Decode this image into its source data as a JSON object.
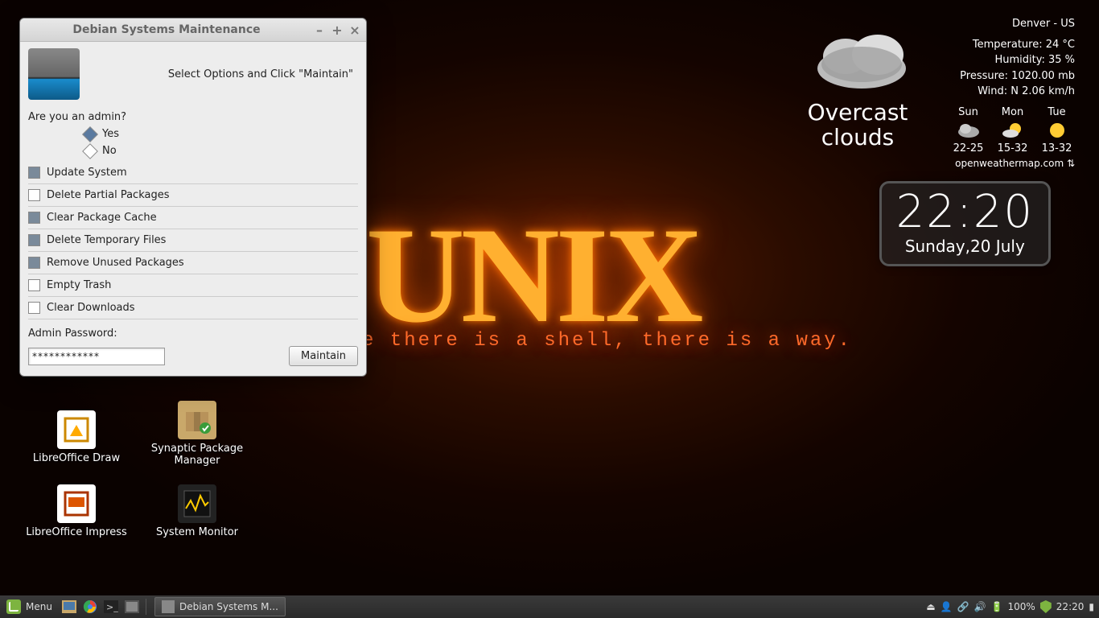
{
  "wallpaper": {
    "title": "UNIX",
    "subtitle": "e there is a shell, there is a way."
  },
  "desktop_icons": {
    "draw": "LibreOffice Draw",
    "impress": "LibreOffice Impress",
    "synaptic": "Synaptic Package Manager",
    "sysmon": "System Monitor"
  },
  "weather": {
    "location": "Denver - US",
    "temp": "Temperature: 24 °C",
    "humidity": "Humidity: 35 %",
    "pressure": "Pressure: 1020.00 mb",
    "wind": "Wind: N 2.06 km/h",
    "condition": "Overcast clouds",
    "days": [
      {
        "name": "Sun",
        "range": "22-25"
      },
      {
        "name": "Mon",
        "range": "15-32"
      },
      {
        "name": "Tue",
        "range": "13-32"
      }
    ],
    "source": "openweathermap.com ⇅"
  },
  "clock": {
    "time": "22:20",
    "date": "Sunday,20 July"
  },
  "window": {
    "title": "Debian Systems Maintenance",
    "instruction": "Select Options and Click \"Maintain\"",
    "question": "Are you an admin?",
    "yes": "Yes",
    "no": "No",
    "opts": {
      "update": "Update System",
      "partial": "Delete Partial Packages",
      "cache": "Clear Package Cache",
      "temp": "Delete Temporary Files",
      "unused": "Remove Unused Packages",
      "trash": "Empty Trash",
      "downloads": "Clear Downloads"
    },
    "pwlabel": "Admin Password:",
    "pwvalue": "************",
    "maintain": "Maintain"
  },
  "panel": {
    "menu": "Menu",
    "task": "Debian Systems M...",
    "battery": "100%",
    "clock": "22:20"
  }
}
